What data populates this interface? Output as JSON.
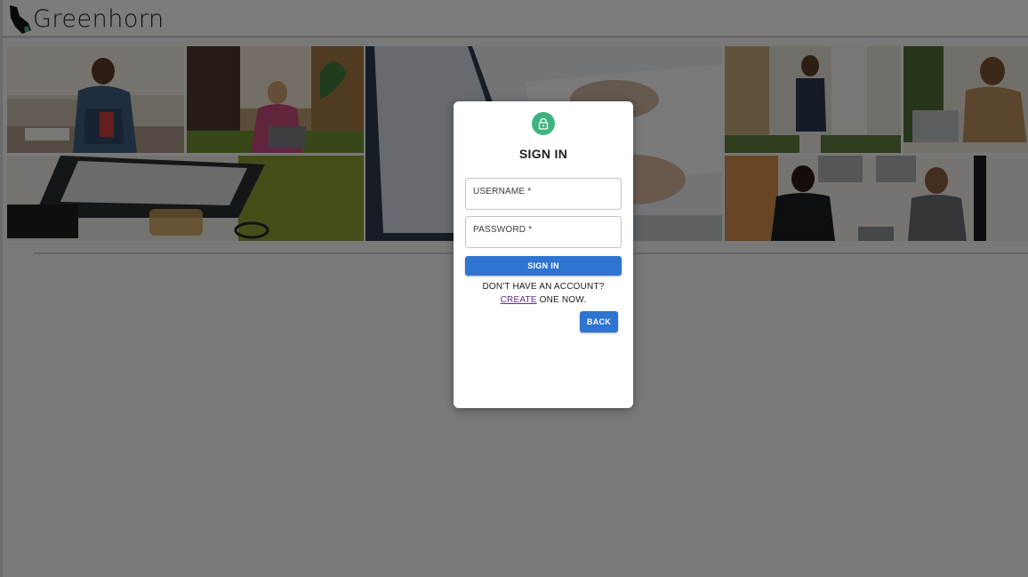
{
  "brand": {
    "name": "Greenhorn",
    "logo_icon": "horn-logo-icon",
    "accent": "#3fb37f"
  },
  "hero": {
    "photos": [
      "man-with-notebook-photo",
      "woman-with-laptop-photo",
      "laptop-keyboard-photo",
      "hands-typing-photo",
      "man-standing-photo",
      "man-at-laptop-photo",
      "two-women-talking-photo"
    ]
  },
  "modal": {
    "lock_icon": "lock-icon",
    "title": "SIGN IN",
    "username": {
      "label": "USERNAME *",
      "value": ""
    },
    "password": {
      "label": "PASSWORD *",
      "value": ""
    },
    "submit_label": "SIGN IN",
    "prompt_line": "DON'T HAVE AN ACCOUNT?",
    "create_link": "CREATE",
    "create_suffix": " ONE NOW.",
    "back_label": "BACK",
    "button_color": "#2f74d0"
  }
}
